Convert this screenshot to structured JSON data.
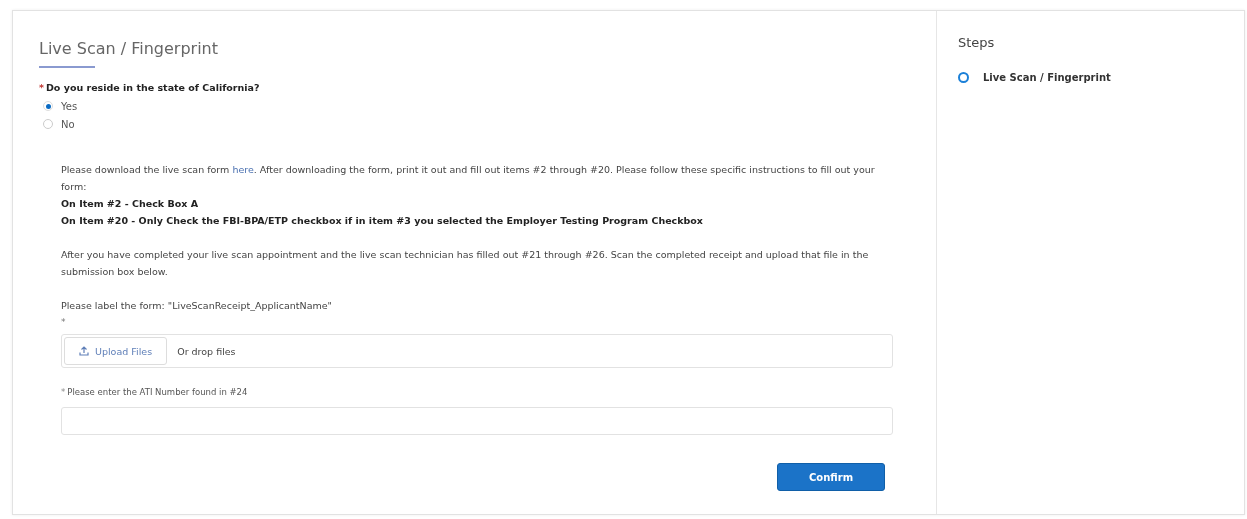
{
  "form": {
    "title": "Live Scan / Fingerprint",
    "question": {
      "required_mark": "*",
      "label": "Do you reside in the state of California?",
      "options": [
        {
          "label": "Yes",
          "selected": true
        },
        {
          "label": "No",
          "selected": false
        }
      ]
    },
    "instructions": {
      "before_link": "Please download the live scan form ",
      "link": "here",
      "after_link": ". After downloading the form, print it out and fill out items #2 through #20. Please follow these specific instructions to fill out your form:",
      "bold_lines": [
        "On Item #2 - Check Box A",
        "On Item #20 - Only Check the FBI-BPA/ETP checkbox if in item #3 you selected the Employer Testing Program Checkbox"
      ],
      "after_appointment": "After you have completed your live scan appointment and the live scan technician has filled out #21 through #26. Scan the completed receipt and upload that file in the submission box below.",
      "label_hint": "Please label the form: \"LiveScanReceipt_ApplicantName\""
    },
    "upload": {
      "required_mark": "*",
      "button": "Upload Files",
      "drop_text": "Or drop files"
    },
    "ati_field": {
      "required_mark": "*",
      "label": "Please enter the ATI Number found in #24"
    },
    "confirm_button": "Confirm"
  },
  "steps": {
    "title": "Steps",
    "items": [
      {
        "label": "Live Scan / Fingerprint",
        "selected": true
      }
    ]
  }
}
